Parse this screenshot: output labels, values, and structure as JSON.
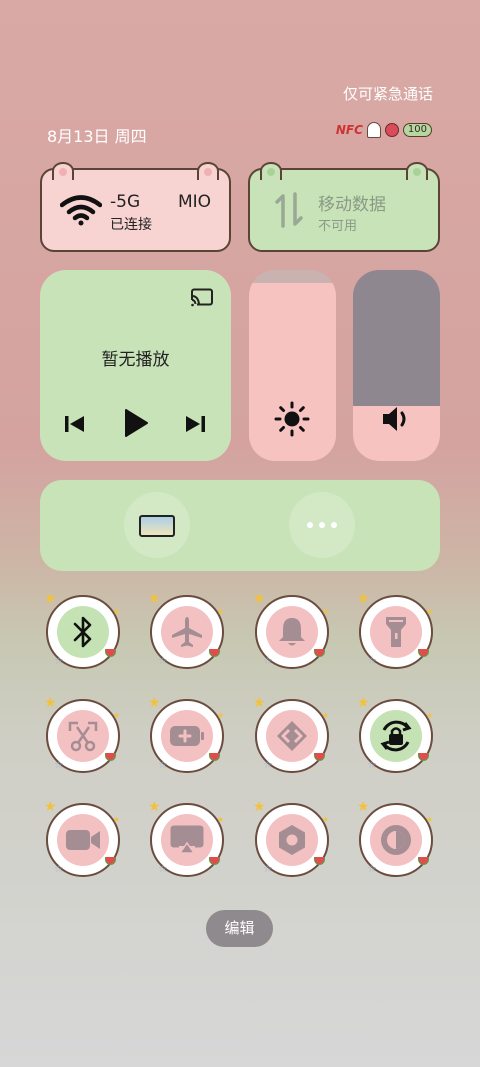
{
  "header": {
    "emergency_text": "仅可紧急通话",
    "date_text": "8月13日 周四"
  },
  "status_bar": {
    "nfc_label": "NFC",
    "battery_level": "100",
    "accent_color": "#d94d5a"
  },
  "wifi_card": {
    "ssid_part1": "-5G",
    "ssid_part2": "MIO",
    "status": "已连接",
    "icon": "wifi-icon"
  },
  "mobile_card": {
    "title": "移动数据",
    "status": "不可用",
    "icon": "mobile-data-icon"
  },
  "media_card": {
    "title": "暂无播放",
    "icons": [
      "cast-icon",
      "previous-icon",
      "play-icon",
      "next-icon"
    ]
  },
  "sliders": {
    "brightness_level_percent": 93,
    "volume_level_percent": 29
  },
  "quick_tiles": [
    {
      "name": "bluetooth",
      "active": true
    },
    {
      "name": "airplane-mode",
      "active": false
    },
    {
      "name": "do-not-disturb",
      "active": false
    },
    {
      "name": "flashlight",
      "active": false
    },
    {
      "name": "screenshot",
      "active": false
    },
    {
      "name": "battery-saver",
      "active": false
    },
    {
      "name": "link-connect",
      "active": false
    },
    {
      "name": "rotation-lock",
      "active": true
    },
    {
      "name": "screen-record",
      "active": false
    },
    {
      "name": "screen-cast",
      "active": false
    },
    {
      "name": "settings",
      "active": false
    },
    {
      "name": "dark-mode",
      "active": false
    }
  ],
  "footer": {
    "edit_label": "编辑"
  },
  "colors": {
    "pink": "#f4c1c3",
    "green": "#c9e3b9",
    "border": "#5b4437"
  }
}
